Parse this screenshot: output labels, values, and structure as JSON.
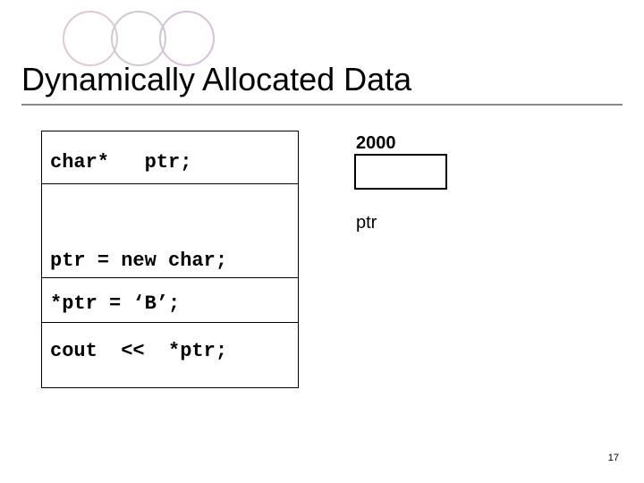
{
  "title": "Dynamically Allocated Data",
  "code": {
    "l1": "char*   ptr;",
    "l2": "ptr = new char;",
    "l3": "*ptr = ‘B’;",
    "l4": "cout  <<  *ptr;"
  },
  "memory": {
    "address": "2000",
    "label": "ptr"
  },
  "page_number": "17"
}
